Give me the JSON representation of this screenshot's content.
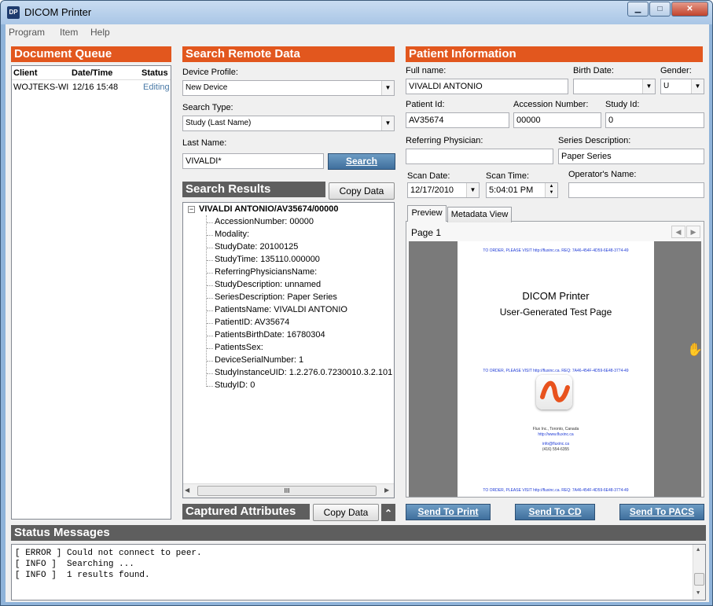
{
  "window": {
    "title": "DICOM Printer",
    "icon_text": "DP"
  },
  "menu": [
    "Program",
    "Item",
    "Help"
  ],
  "queue": {
    "title": "Document Queue",
    "columns": [
      "Client",
      "Date/Time",
      "Status"
    ],
    "rows": [
      {
        "client": "WOJTEKS-WI",
        "datetime": "12/16 15:48",
        "status": "Editing"
      }
    ]
  },
  "search": {
    "title": "Search Remote Data",
    "device_profile_label": "Device Profile:",
    "device_profile_value": "New Device",
    "search_type_label": "Search Type:",
    "search_type_value": "Study (Last Name)",
    "last_name_label": "Last Name:",
    "last_name_value": "VIVALDI*",
    "search_button": "Search"
  },
  "results": {
    "title": "Search Results",
    "copy_button": "Copy Data",
    "root": "VIVALDI ANTONIO/AV35674/00000",
    "expander": "−",
    "items": [
      "AccessionNumber: 00000",
      "Modality:",
      "StudyDate: 20100125",
      "StudyTime: 135110.000000",
      "ReferringPhysiciansName:",
      "StudyDescription: unnamed",
      "SeriesDescription: Paper Series",
      "PatientsName: VIVALDI ANTONIO",
      "PatientID: AV35674",
      "PatientsBirthDate: 16780304",
      "PatientsSex:",
      "DeviceSerialNumber: 1",
      "StudyInstanceUID: 1.2.276.0.7230010.3.2.101",
      "StudyID: 0"
    ],
    "hscroll_grip": "III"
  },
  "captured": {
    "title": "Captured Attributes",
    "copy_button": "Copy Data",
    "collapse_glyph": "⌃"
  },
  "patient": {
    "title": "Patient Information",
    "full_name_label": "Full name:",
    "full_name": "VIVALDI ANTONIO",
    "birth_date_label": "Birth Date:",
    "birth_date": "",
    "gender_label": "Gender:",
    "gender": "U",
    "patient_id_label": "Patient Id:",
    "patient_id": "AV35674",
    "accession_label": "Accession Number:",
    "accession": "00000",
    "study_id_label": "Study Id:",
    "study_id": "0",
    "ref_phys_label": "Referring Physician:",
    "ref_phys": "",
    "series_desc_label": "Series Description:",
    "series_desc": "Paper Series",
    "scan_date_label": "Scan Date:",
    "scan_date": "12/17/2010",
    "scan_time_label": "Scan Time:",
    "scan_time": "5:04:01 PM",
    "operator_label": "Operator's Name:",
    "operator": ""
  },
  "preview": {
    "tabs": [
      "Preview",
      "Metadata View"
    ],
    "page_label": "Page 1",
    "banner": "TO ORDER, PLEASE VISIT http://fluxinc.ca. REQ: 7A46-454F-4D59-6E48-3774-49",
    "doc_title1": "DICOM Printer",
    "doc_title2": "User-Generated Test Page",
    "company": "Flux Inc., Toronto, Canada",
    "site": "http://www.fluxinc.ca",
    "email": "info@fluxinc.ca",
    "phone": "(416) 554-6355"
  },
  "send_buttons": [
    "Send To Print",
    "Send To CD",
    "Send To PACS"
  ],
  "status": {
    "title": "Status Messages",
    "lines": [
      "[ ERROR ] Could not connect to peer.",
      "[ INFO ]  Searching ...",
      "[ INFO ]  1 results found."
    ]
  },
  "colors": {
    "accent": "#e2571e",
    "header_dark": "#5e5e5e",
    "button_blue": "#4a7aa7"
  }
}
